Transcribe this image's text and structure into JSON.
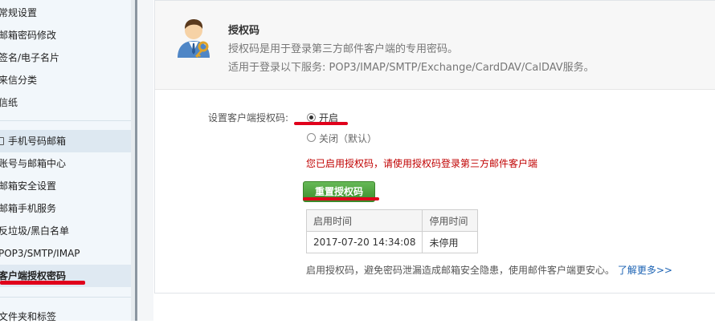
{
  "sidebar": {
    "items": [
      {
        "label": "常规设置"
      },
      {
        "label": "邮箱密码修改"
      },
      {
        "label": "签名/电子名片"
      },
      {
        "label": "来信分类"
      },
      {
        "label": "信纸"
      },
      {
        "label": "手机号码邮箱"
      },
      {
        "label": "账号与邮箱中心"
      },
      {
        "label": "邮箱安全设置"
      },
      {
        "label": "邮箱手机服务"
      },
      {
        "label": "反垃圾/黑白名单"
      },
      {
        "label": "POP3/SMTP/IMAP"
      },
      {
        "label": "客户端授权密码"
      },
      {
        "label": "文件夹和标签"
      }
    ]
  },
  "header": {
    "title": "授权码",
    "desc1": "授权码是用于登录第三方邮件客户端的专用密码。",
    "desc2": "适用于登录以下服务: POP3/IMAP/SMTP/Exchange/CardDAV/CalDAV服务。"
  },
  "settings": {
    "label": "设置客户端授权码:",
    "option_on": "开启",
    "option_off": "关闭（默认）",
    "selected": "on",
    "status_message": "您已启用授权码，请使用授权码登录第三方邮件客户端",
    "reset_button": "重置授权码"
  },
  "time_table": {
    "headers": [
      "启用时间",
      "停用时间"
    ],
    "rows": [
      [
        "2017-07-20 14:34:08",
        "未停用"
      ]
    ]
  },
  "footer": {
    "note": "启用授权码，避免密码泄漏造成邮箱安全隐患，使用邮件客户端更安心。",
    "link": "了解更多>>"
  },
  "colors": {
    "accent_green": "#4ca33b",
    "warning_red": "#c00000",
    "link_blue": "#1b62b3",
    "annotation_red": "#e0001b"
  }
}
